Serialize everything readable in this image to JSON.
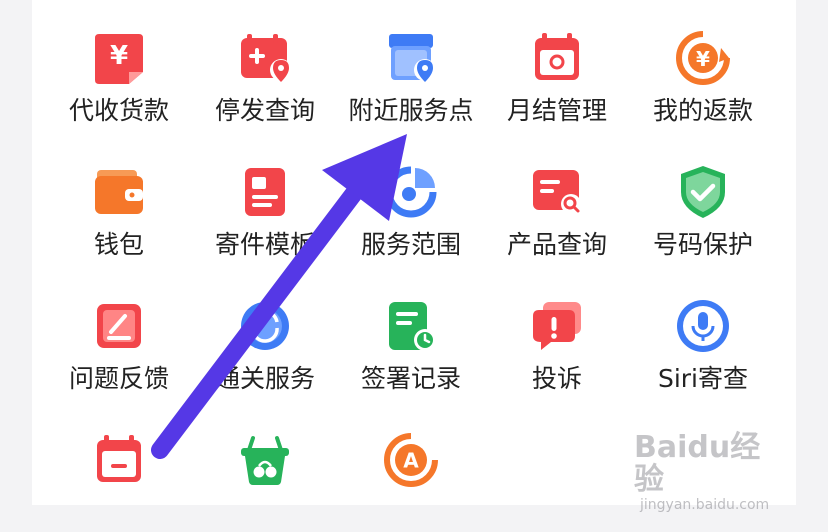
{
  "menu": {
    "rows": [
      [
        {
          "label": "代收货款",
          "icon": "payment-collection-icon"
        },
        {
          "label": "停发查询",
          "icon": "suspended-delivery-icon"
        },
        {
          "label": "附近服务点",
          "icon": "nearby-service-point-icon"
        },
        {
          "label": "月结管理",
          "icon": "monthly-billing-icon"
        },
        {
          "label": "我的返款",
          "icon": "my-refund-icon"
        }
      ],
      [
        {
          "label": "钱包",
          "icon": "wallet-icon"
        },
        {
          "label": "寄件模板",
          "icon": "shipping-template-icon"
        },
        {
          "label": "服务范围",
          "icon": "service-area-icon"
        },
        {
          "label": "产品查询",
          "icon": "product-search-icon"
        },
        {
          "label": "号码保护",
          "icon": "number-protection-icon"
        }
      ],
      [
        {
          "label": "问题反馈",
          "icon": "feedback-icon"
        },
        {
          "label": "通关服务",
          "icon": "customs-service-icon"
        },
        {
          "label": "签署记录",
          "icon": "sign-record-icon"
        },
        {
          "label": "投诉",
          "icon": "complaint-icon"
        },
        {
          "label": "Siri寄查",
          "icon": "siri-icon"
        }
      ],
      [
        {
          "label": "",
          "icon": "calendar-icon"
        },
        {
          "label": "",
          "icon": "fruit-basket-icon"
        },
        {
          "label": "",
          "icon": "a-circle-icon"
        }
      ]
    ]
  },
  "watermark": {
    "brand": "Baidu经验",
    "url": "jingyan.baidu.com"
  },
  "colors": {
    "red": "#f2454a",
    "orange": "#f5772a",
    "blue": "#3e7bf5",
    "green": "#27b35a",
    "arrow": "#5538e6"
  }
}
